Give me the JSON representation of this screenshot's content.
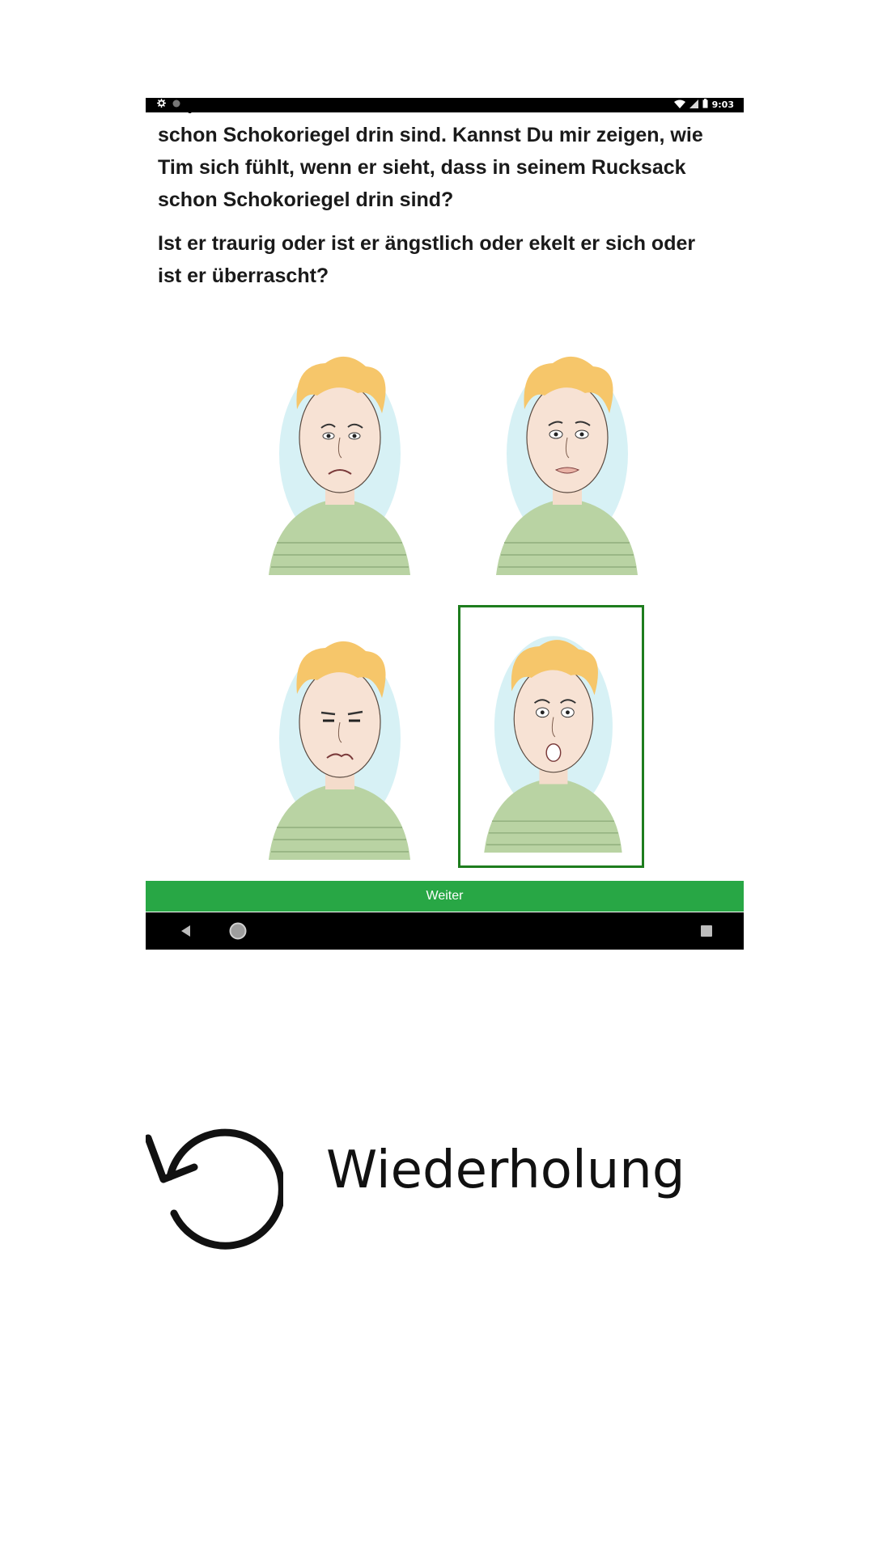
{
  "status_bar": {
    "clock": "9:03",
    "icons": [
      "settings-icon",
      "notification-dot-icon",
      "wifi-icon",
      "signal-icon",
      "battery-icon"
    ]
  },
  "story": {
    "line_top": "einpacken möchte, stellt er fest, dass in seinem Rucksack schon Schokoriegel drin sind. Kannst Du mir zeigen, wie Tim sich fühlt, wenn er sieht, dass in seinem Rucksack schon Schokoriegel drin sind?",
    "question": "Ist er traurig oder ist er ängstlich oder ekelt er sich oder ist er überrascht?"
  },
  "choices": [
    {
      "emotion": "traurig",
      "selected": false
    },
    {
      "emotion": "ängstlich",
      "selected": false
    },
    {
      "emotion": "ekelt sich",
      "selected": false
    },
    {
      "emotion": "überrascht",
      "selected": true
    }
  ],
  "actions": {
    "next_label": "Weiter",
    "next_color": "#28a745"
  },
  "navigation": {
    "icons": [
      "back-icon",
      "home-icon",
      "recents-icon"
    ]
  },
  "replay": {
    "label": "Wiederholung",
    "icon": "replay-icon"
  },
  "colors": {
    "selected_border": "#1e7d1e",
    "status_bar": "#000000"
  }
}
